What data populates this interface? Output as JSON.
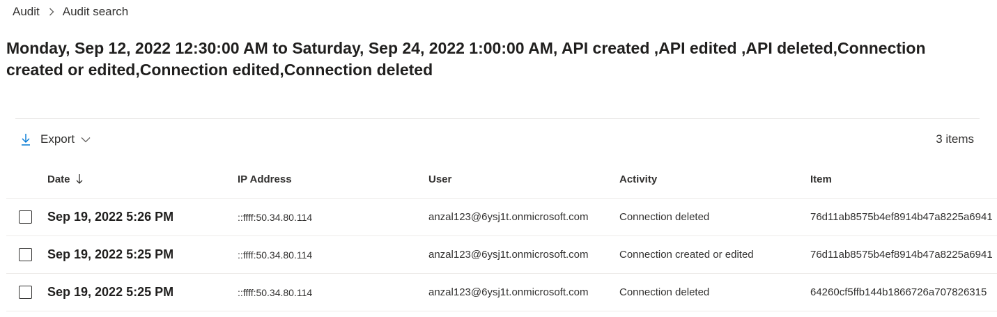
{
  "breadcrumb": {
    "items": [
      {
        "label": "Audit"
      },
      {
        "label": "Audit search"
      }
    ]
  },
  "page_title": "Monday, Sep 12, 2022 12:30:00 AM to Saturday, Sep 24, 2022 1:00:00 AM, API created ,API edited ,API deleted,Connection created or edited,Connection edited,Connection deleted",
  "toolbar": {
    "export_label": "Export",
    "item_count": "3 items"
  },
  "table": {
    "columns": {
      "date": "Date",
      "ip": "IP Address",
      "user": "User",
      "activity": "Activity",
      "item": "Item"
    },
    "sort": {
      "column": "date",
      "direction": "descending"
    },
    "rows": [
      {
        "date": "Sep 19, 2022 5:26 PM",
        "ip": "::ffff:50.34.80.114",
        "user": "anzal123@6ysj1t.onmicrosoft.com",
        "activity": "Connection deleted",
        "item": "76d11ab8575b4ef8914b47a8225a6941",
        "selected": false
      },
      {
        "date": "Sep 19, 2022 5:25 PM",
        "ip": "::ffff:50.34.80.114",
        "user": "anzal123@6ysj1t.onmicrosoft.com",
        "activity": "Connection created or edited",
        "item": "76d11ab8575b4ef8914b47a8225a6941",
        "selected": false
      },
      {
        "date": "Sep 19, 2022 5:25 PM",
        "ip": "::ffff:50.34.80.114",
        "user": "anzal123@6ysj1t.onmicrosoft.com",
        "activity": "Connection deleted",
        "item": "64260cf5ffb144b1866726a707826315",
        "selected": false
      }
    ]
  },
  "icons": {
    "breadcrumb_separator": "chevron-right-icon",
    "export": "download-arrow-icon",
    "export_menu": "chevron-down-icon",
    "sort": "arrow-down-icon",
    "row_select": "checkbox-icon"
  },
  "colors": {
    "accent": "#0078d4",
    "text": "#323130",
    "divider": "#edebe9"
  }
}
